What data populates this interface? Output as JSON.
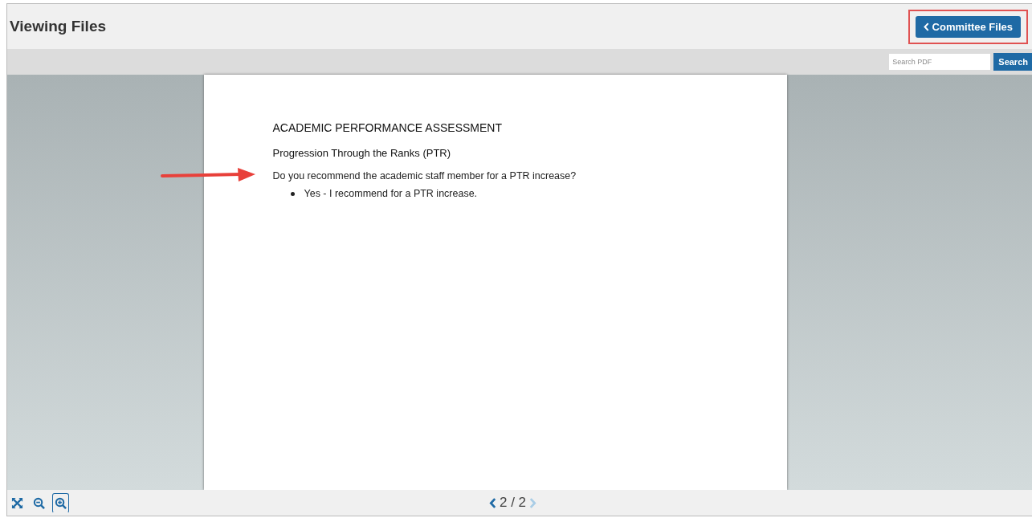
{
  "header": {
    "title": "Viewing Files",
    "back_button": {
      "label": "Committee Files",
      "highlighted": true
    }
  },
  "search": {
    "placeholder": "Search PDF",
    "button": "Search"
  },
  "document": {
    "heading": "ACADEMIC PERFORMANCE ASSESSMENT",
    "subheading": "Progression Through the Ranks (PTR)",
    "question": "Do you recommend the academic staff member for a PTR increase?",
    "answers": [
      "Yes - I recommend for a PTR increase."
    ],
    "pointer_arrow": true
  },
  "zoom_tools": [
    {
      "kind": "fit",
      "selected": false
    },
    {
      "kind": "zoom_out",
      "selected": false
    },
    {
      "kind": "zoom_in",
      "selected": true
    }
  ],
  "pager": {
    "label": "2 / 2",
    "prev_disabled": false,
    "next_disabled": true
  }
}
